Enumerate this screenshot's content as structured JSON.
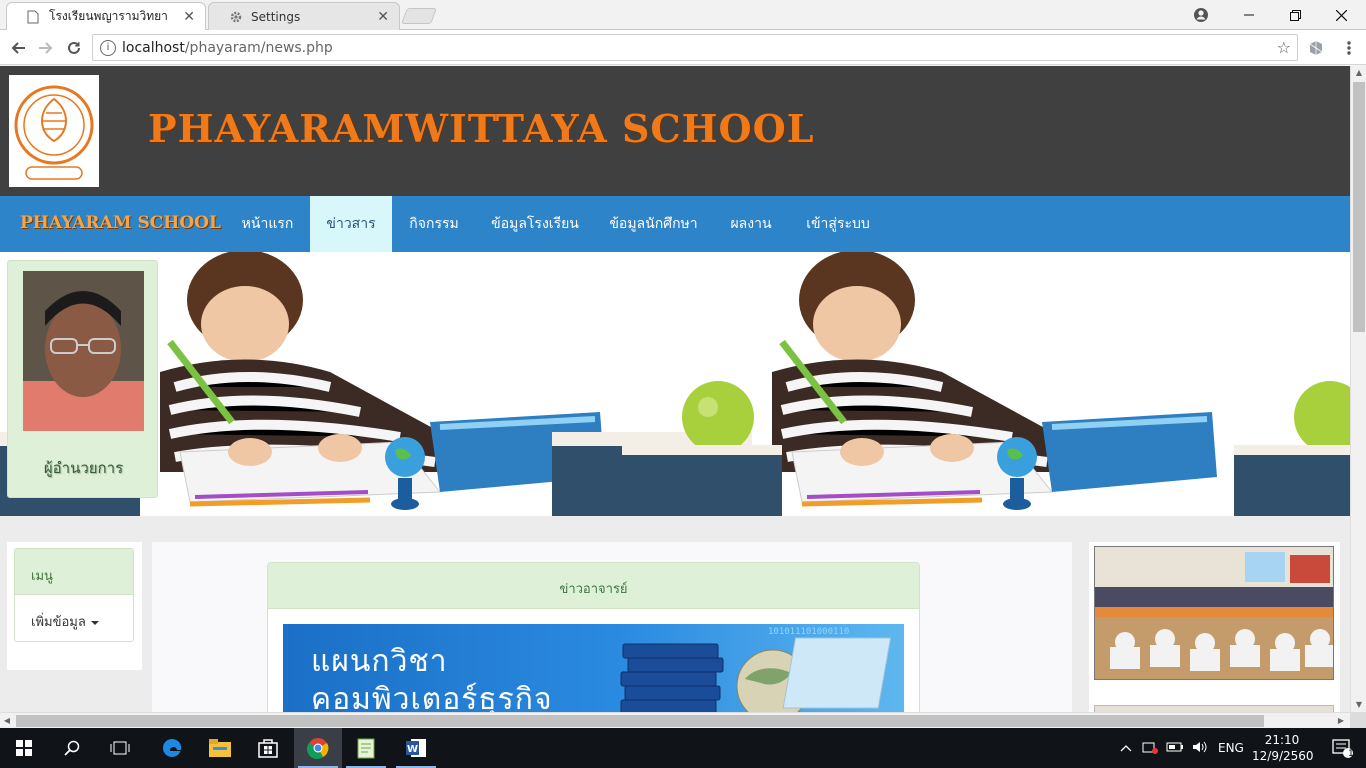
{
  "browser": {
    "tabs": [
      {
        "title": "โรงเรียนพญารามวิทยา",
        "close": "✕"
      },
      {
        "title": "Settings",
        "close": "✕"
      }
    ],
    "address": {
      "host": "localhost",
      "path": "/phayaram/news.php"
    }
  },
  "site": {
    "title": "PHAYARAMWITTAYA  SCHOOL",
    "brand": "PHAYARAM SCHOOL",
    "nav": [
      "หน้าแรก",
      "ข่าวสาร",
      "กิจกรรม",
      "ข้อมูลโรงเรียน",
      "ข้อมูลนักศึกษา",
      "ผลงาน",
      "เข้าสู่ระบบ"
    ],
    "active_nav": "ข่าวสาร",
    "director_label": "ผู้อำนวยการ",
    "menu": {
      "header": "เมนู",
      "add": "เพิ่มข้อมูล"
    },
    "news": {
      "header": "ข่าวอาจารย์",
      "banner_line1": "แผนกวิชา",
      "banner_line2": "คอมพิวเตอร์ธุรกิจ",
      "banner_digits": "101011101000110"
    }
  },
  "taskbar": {
    "language": "ENG",
    "time": "21:10",
    "date": "12/9/2560",
    "notifications": "1"
  }
}
